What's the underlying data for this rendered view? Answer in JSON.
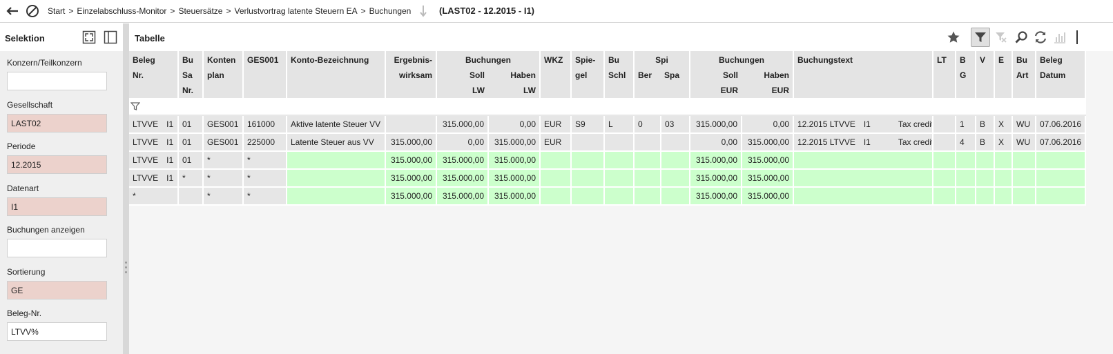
{
  "breadcrumb": [
    "Start",
    "Einzelabschluss-Monitor",
    "Steuersätze",
    "Verlustvortrag latente Steuern EA",
    "Buchungen"
  ],
  "breadcrumb_sep": ">",
  "context": "(LAST02 - 12.2015 - I1)",
  "left": {
    "title": "Selektion",
    "fields": [
      {
        "label": "Konzern/Teilkonzern",
        "value": "",
        "required": false
      },
      {
        "label": "Gesellschaft",
        "value": "LAST02",
        "required": true
      },
      {
        "label": "Periode",
        "value": "12.2015",
        "required": true
      },
      {
        "label": "Datenart",
        "value": "I1",
        "required": true
      },
      {
        "label": "Buchungen anzeigen",
        "value": "",
        "required": false
      },
      {
        "label": "Sortierung",
        "value": "GE",
        "required": true
      },
      {
        "label": "Beleg-Nr.",
        "value": "LTVV%",
        "required": false
      }
    ]
  },
  "main": {
    "title": "Tabelle",
    "toolbar": [
      "star-icon",
      "filter-icon",
      "clear-filter-icon",
      "search-icon",
      "refresh-icon",
      "chart-icon"
    ]
  },
  "table": {
    "headers": {
      "beleg": [
        "Beleg",
        "Nr."
      ],
      "busa": [
        "Bu",
        "Sa",
        "Nr."
      ],
      "konten": [
        "Konten",
        "plan"
      ],
      "ges": [
        "GES001"
      ],
      "bez": [
        "Konto-Bezeichnung"
      ],
      "erg": [
        "Ergebnis-",
        "wirksam"
      ],
      "buchungen_lw": "Buchungen",
      "soll_lw": [
        "Soll",
        "LW"
      ],
      "haben_lw": [
        "Haben",
        "LW"
      ],
      "wkz": [
        "WKZ"
      ],
      "spiegel": [
        "Spie-",
        "gel"
      ],
      "buschl": [
        "Bu",
        "Schl"
      ],
      "spi": "Spi",
      "ber": "Ber",
      "spa": "Spa",
      "buchungen_eur": "Buchungen",
      "soll_eur": [
        "Soll",
        "EUR"
      ],
      "haben_eur": [
        "Haben",
        "EUR"
      ],
      "text": [
        "Buchungstext"
      ],
      "lt": [
        "LT"
      ],
      "bg": [
        "B",
        "G"
      ],
      "v": [
        "V"
      ],
      "e": [
        "E"
      ],
      "buart": [
        "Bu",
        "Art"
      ],
      "datum": [
        "Beleg",
        "Datum"
      ]
    },
    "rows": [
      {
        "beleg": "LTVVE",
        "beleg2": "I1",
        "busa": "01",
        "konten": "GES001",
        "ges": "161000",
        "bez": "Aktive latente Steuer VV",
        "erg": "",
        "soll_lw": "315.000,00",
        "haben_lw": "0,00",
        "wkz": "EUR",
        "spiegel": "S9",
        "buschl": "L",
        "ber": "0",
        "spa": "03",
        "soll_eur": "315.000,00",
        "haben_eur": "0,00",
        "text1": "12.2015 LTVVE",
        "text2": "I1",
        "text3": "Tax credit",
        "lt": "",
        "bg": "1",
        "v": "B",
        "e": "X",
        "buart": "WU",
        "datum": "07.06.2016",
        "sum": false
      },
      {
        "beleg": "LTVVE",
        "beleg2": "I1",
        "busa": "01",
        "konten": "GES001",
        "ges": "225000",
        "bez": "Latente Steuer aus VV",
        "erg": "315.000,00",
        "soll_lw": "0,00",
        "haben_lw": "315.000,00",
        "wkz": "EUR",
        "spiegel": "",
        "buschl": "",
        "ber": "",
        "spa": "",
        "soll_eur": "0,00",
        "haben_eur": "315.000,00",
        "text1": "12.2015 LTVVE",
        "text2": "I1",
        "text3": "Tax credit",
        "lt": "",
        "bg": "4",
        "v": "B",
        "e": "X",
        "buart": "WU",
        "datum": "07.06.2016",
        "sum": false
      },
      {
        "beleg": "LTVVE",
        "beleg2": "I1",
        "busa": "01",
        "konten": "*",
        "ges": "*",
        "bez": "",
        "erg": "315.000,00",
        "soll_lw": "315.000,00",
        "haben_lw": "315.000,00",
        "wkz": "",
        "spiegel": "",
        "buschl": "",
        "ber": "",
        "spa": "",
        "soll_eur": "315.000,00",
        "haben_eur": "315.000,00",
        "text1": "",
        "text2": "",
        "text3": "",
        "lt": "",
        "bg": "",
        "v": "",
        "e": "",
        "buart": "",
        "datum": "",
        "sum": true
      },
      {
        "beleg": "LTVVE",
        "beleg2": "I1",
        "busa": "*",
        "konten": "*",
        "ges": "*",
        "bez": "",
        "erg": "315.000,00",
        "soll_lw": "315.000,00",
        "haben_lw": "315.000,00",
        "wkz": "",
        "spiegel": "",
        "buschl": "",
        "ber": "",
        "spa": "",
        "soll_eur": "315.000,00",
        "haben_eur": "315.000,00",
        "text1": "",
        "text2": "",
        "text3": "",
        "lt": "",
        "bg": "",
        "v": "",
        "e": "",
        "buart": "",
        "datum": "",
        "sum": true
      },
      {
        "beleg": "*",
        "beleg2": "",
        "busa": "",
        "konten": "*",
        "ges": "*",
        "bez": "",
        "erg": "315.000,00",
        "soll_lw": "315.000,00",
        "haben_lw": "315.000,00",
        "wkz": "",
        "spiegel": "",
        "buschl": "",
        "ber": "",
        "spa": "",
        "soll_eur": "315.000,00",
        "haben_eur": "315.000,00",
        "text1": "",
        "text2": "",
        "text3": "",
        "lt": "",
        "bg": "",
        "v": "",
        "e": "",
        "buart": "",
        "datum": "",
        "sum": true
      }
    ]
  }
}
